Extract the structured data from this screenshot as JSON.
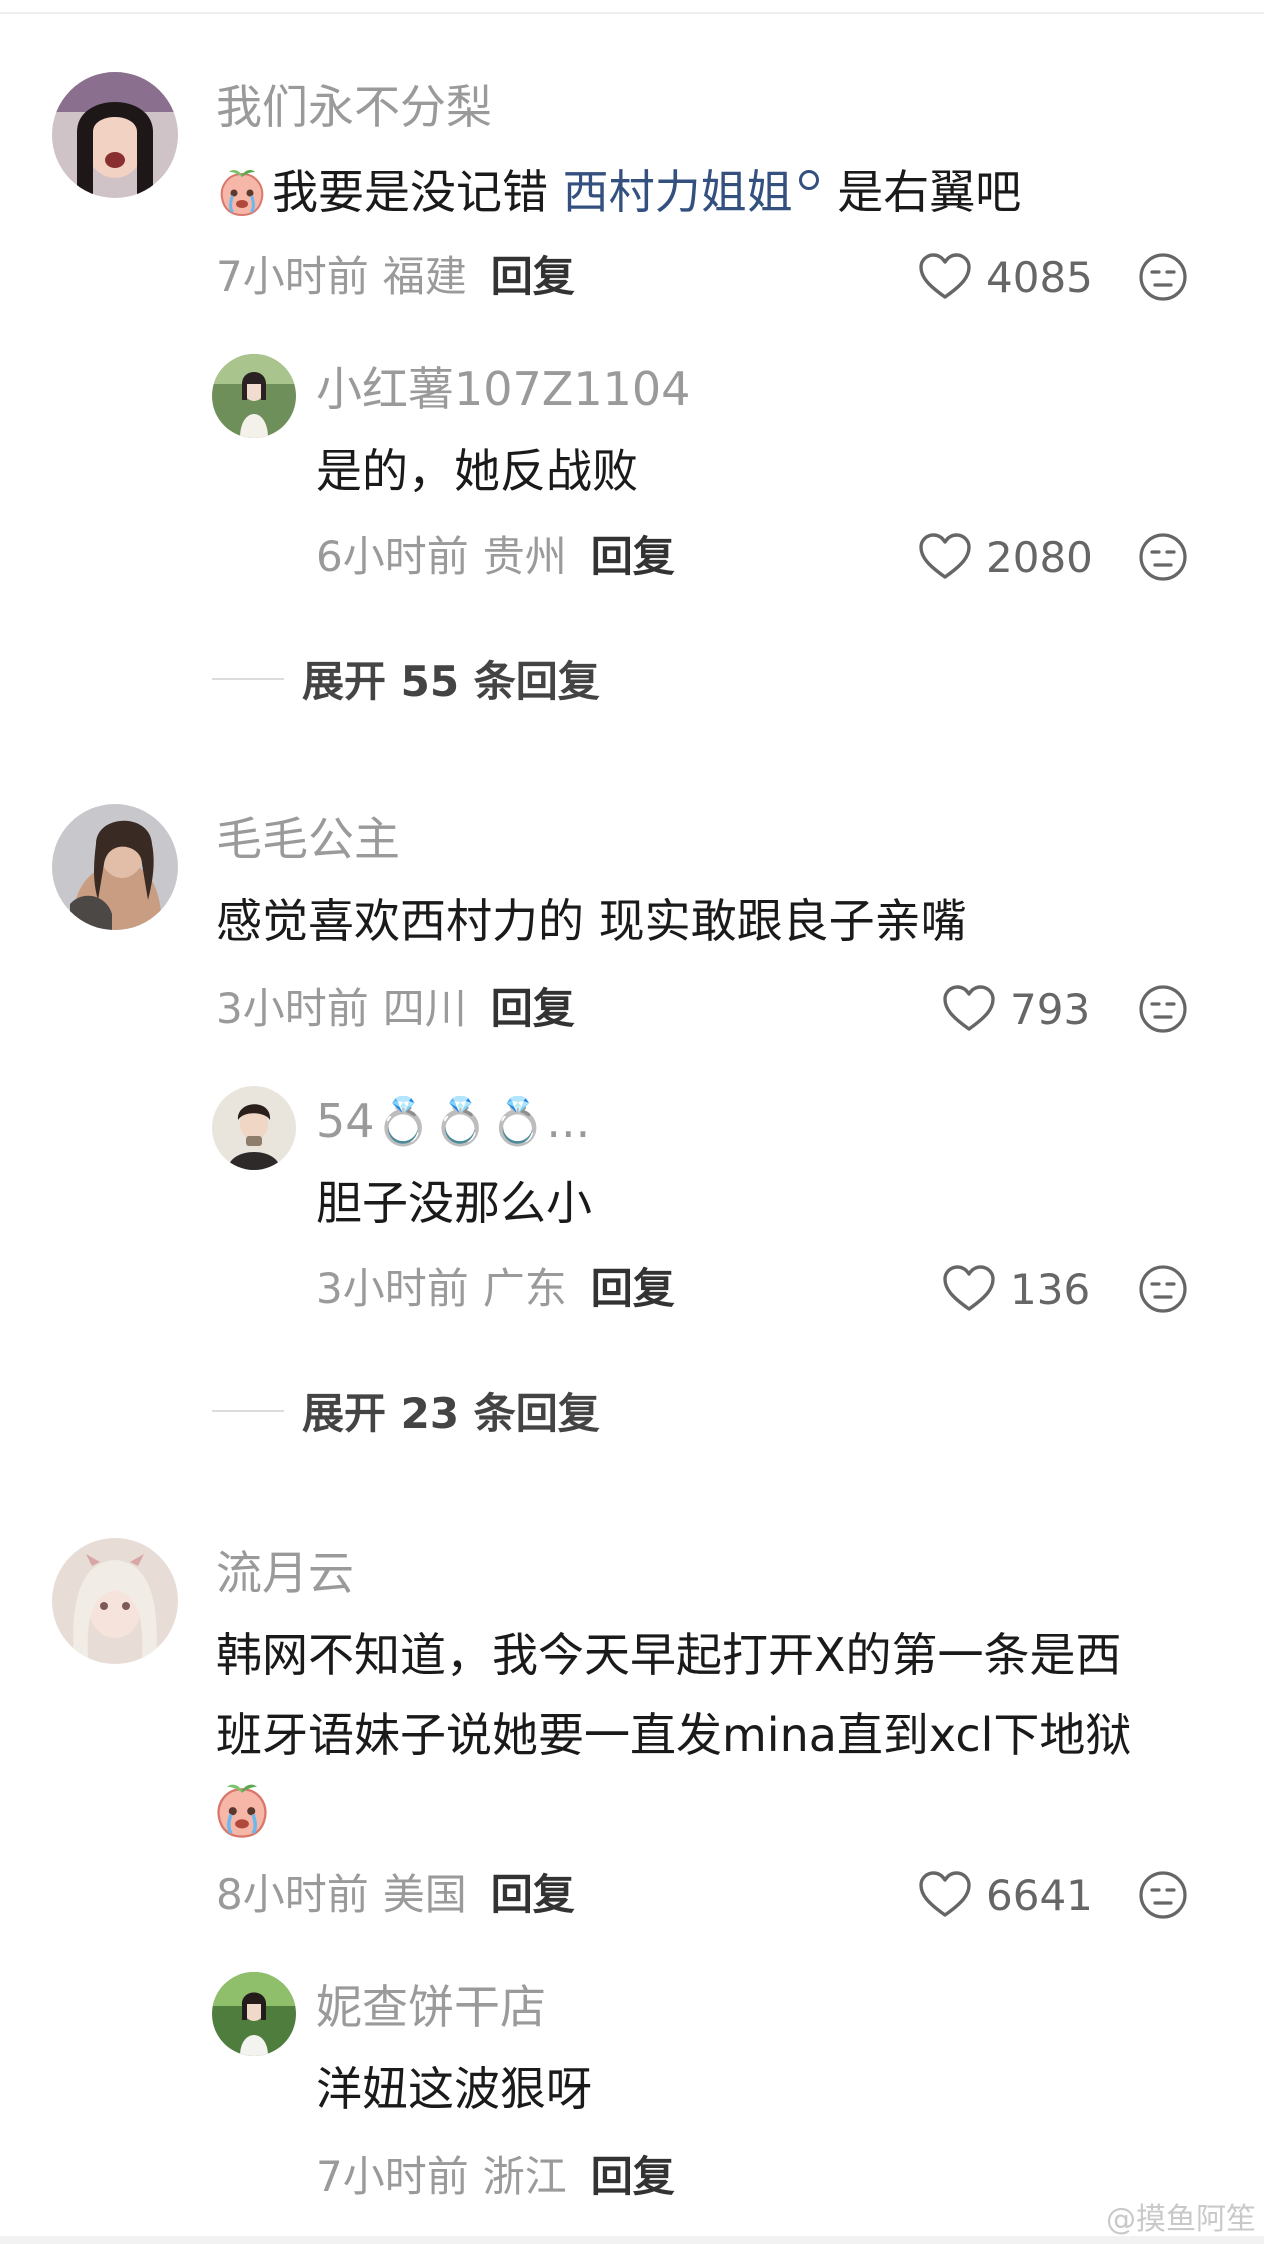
{
  "comments": [
    {
      "user": "我们永不分梨",
      "text_before": "我要是没记错 ",
      "mention": "西村力姐姐",
      "text_after": " 是右翼吧",
      "time": "7小时前",
      "region": "福建",
      "reply_label": "回复",
      "likes": "4085",
      "reply": {
        "user": "小红薯107Z1104",
        "text": "是的，她反战败",
        "time": "6小时前",
        "region": "贵州",
        "reply_label": "回复",
        "likes": "2080"
      },
      "expand": "展开 55 条回复"
    },
    {
      "user": "毛毛公主",
      "text": "感觉喜欢西村力的 现实敢跟良子亲嘴",
      "time": "3小时前",
      "region": "四川",
      "reply_label": "回复",
      "likes": "793",
      "reply": {
        "user": "54💍💍💍...",
        "text": "胆子没那么小",
        "time": "3小时前",
        "region": "广东",
        "reply_label": "回复",
        "likes": "136"
      },
      "expand": "展开 23 条回复"
    },
    {
      "user": "流月云",
      "text_line1": "韩网不知道，我今天早起打开X的第一条是西",
      "text_line2": "班牙语妹子说她要一直发mina直到xcl下地狱",
      "time": "8小时前",
      "region": "美国",
      "reply_label": "回复",
      "likes": "6641",
      "reply": {
        "user": "妮查饼干店",
        "text": "洋妞这波狠呀",
        "time": "7小时前",
        "region": "浙江",
        "reply_label": "回复"
      }
    }
  ],
  "watermark": "@摸鱼阿笙",
  "icons": {
    "like": "heart-outline-icon",
    "dislike": "neutral-face-icon",
    "emoji": "crying-peach-emoji-icon"
  },
  "colors": {
    "mention": "#33507f",
    "name": "#9a9a9a",
    "text": "#1a1a1a"
  }
}
